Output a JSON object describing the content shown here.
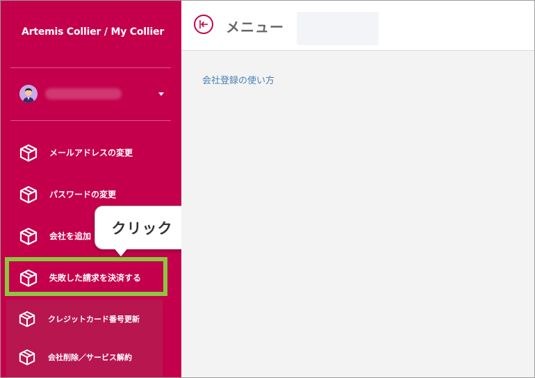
{
  "sidebar": {
    "brand": "Artemis Collier / My Collier",
    "items": [
      {
        "label": "メールアドレスの変更",
        "icon": "box-icon"
      },
      {
        "label": "パスワードの変更",
        "icon": "box-icon"
      },
      {
        "label": "会社を追加",
        "icon": "box-icon"
      },
      {
        "label": "失敗した請求を決済する",
        "icon": "box-icon"
      }
    ],
    "subitems": [
      {
        "label": "クレジットカード番号更新",
        "icon": "box-icon"
      },
      {
        "label": "会社削除／サービス解約",
        "icon": "box-icon"
      }
    ]
  },
  "callout": {
    "text": "クリック"
  },
  "header": {
    "title": "メニュー",
    "back_icon": "arrow-left-bar-icon"
  },
  "main": {
    "help_link": "会社登録の使い方"
  },
  "colors": {
    "sidebar": "#c4004c",
    "highlight": "#8dc63f",
    "link": "#4a7fb5"
  }
}
